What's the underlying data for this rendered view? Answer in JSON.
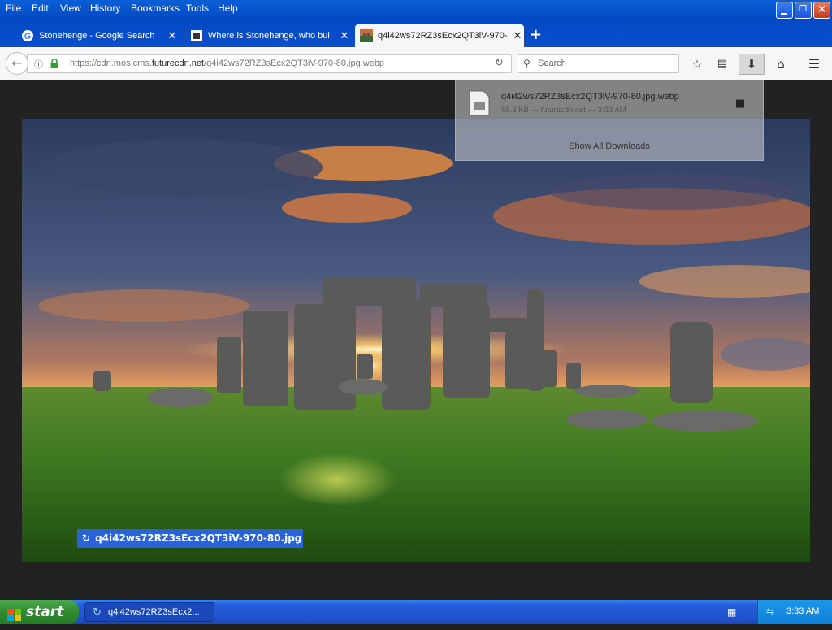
{
  "menu": [
    "File",
    "Edit",
    "View",
    "History",
    "Bookmarks",
    "Tools",
    "Help"
  ],
  "tabs": [
    {
      "title": "Stonehenge - Google Search"
    },
    {
      "title": "Where is Stonehenge, who bui"
    },
    {
      "title": "q4i42ws72RZ3sEcx2QT3iV-970-"
    }
  ],
  "navbar": {
    "url_prefix": "https://cdn.mos.cms.",
    "url_domain": "futurecdn.net",
    "url_path": "/q4i42ws72RZ3sEcx2QT3iV-970-80.jpg.webp",
    "search_placeholder": "Search"
  },
  "downloads": {
    "file_name": "q4i42ws72RZ3sEcx2QT3iV-970-80.jpg.webp",
    "file_meta": "58.3 KB — futurecdn.net — 3:33 AM",
    "show_all": "Show All Downloads"
  },
  "viewer": {
    "caption": "q4i42ws72RZ3sEcx2QT3iV-970-80.jpg"
  },
  "taskbar": {
    "start_label": "start",
    "task_item": "q4i42ws72RZ3sEcx2...",
    "clock": "3:33 AM"
  },
  "colors": {
    "titlebar": "#0a55d0",
    "taskbar": "#245edb",
    "start": "#2f8a2f",
    "caption_bg": "#2a63d6"
  }
}
